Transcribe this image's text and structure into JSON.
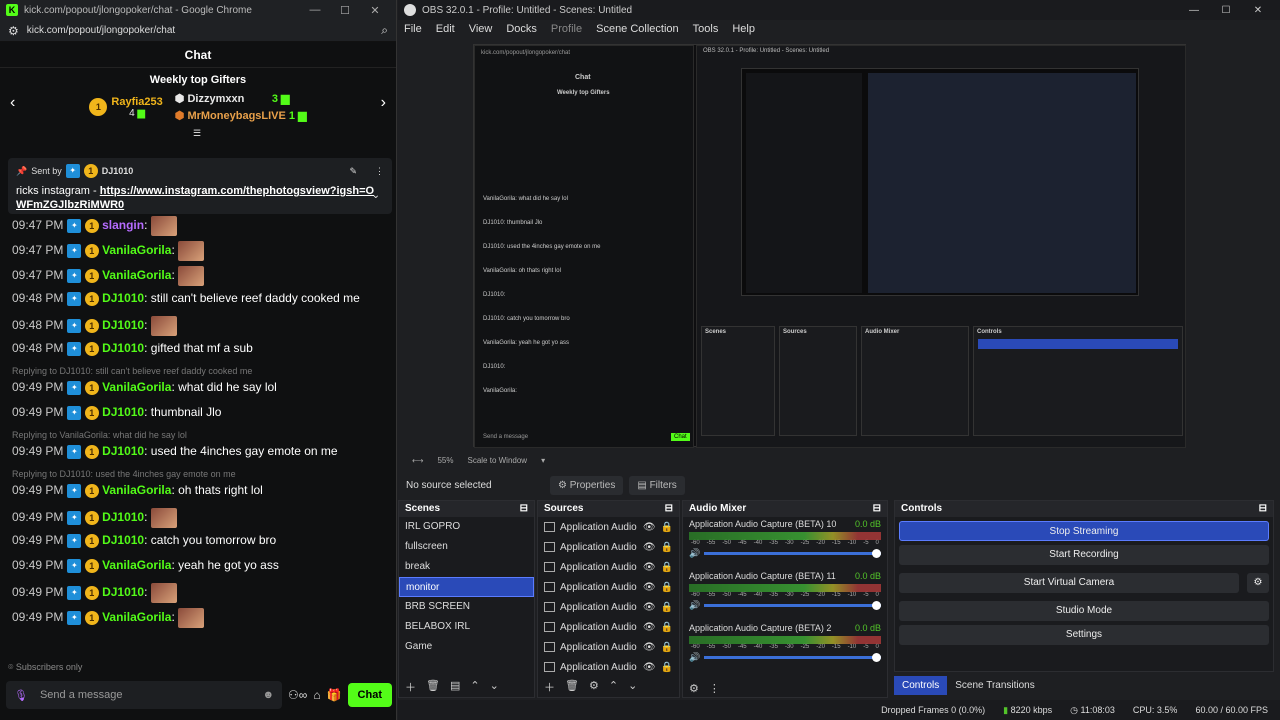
{
  "chrome": {
    "title": "kick.com/popout/jlongopoker/chat - Google Chrome",
    "url": "kick.com/popout/jlongopoker/chat",
    "chat_header": "Chat",
    "gifters_title": "Weekly top Gifters",
    "gifters": [
      {
        "name": "Rayfia253",
        "count": "4",
        "rank": "1"
      },
      {
        "name": "Dizzymxxn",
        "count": "3"
      },
      {
        "name": "MrMoneybagsLIVE",
        "count": "1"
      }
    ],
    "pinned": {
      "sent_by": "Sent by",
      "user": "DJ1010",
      "text": "ricks instagram - ",
      "link": "https://www.instagram.com/thephotogsview?igsh=OWFmZGJlbzRiMWR0"
    },
    "messages": [
      {
        "time": "09:47 PM",
        "user": "slangin",
        "text": ":",
        "color": "#b66cff"
      },
      {
        "time": "09:47 PM",
        "user": "VanilaGorila",
        "text": ":",
        "color": "#53fc18"
      },
      {
        "time": "09:47 PM",
        "user": "VanilaGorila",
        "text": ":",
        "color": "#53fc18"
      },
      {
        "time": "09:48 PM",
        "user": "DJ1010",
        "text": ": still can't believe reef daddy cooked me",
        "color": "#53fc18"
      },
      {
        "time": "09:48 PM",
        "user": "DJ1010",
        "text": ":",
        "color": "#53fc18"
      },
      {
        "time": "09:48 PM",
        "user": "DJ1010",
        "text": ": gifted that mf a sub",
        "color": "#53fc18"
      },
      {
        "time": "09:49 PM",
        "user": "VanilaGorila",
        "text": ": what did he say lol",
        "color": "#53fc18",
        "reply": "Replying to DJ1010: still can't believe reef daddy cooked me"
      },
      {
        "time": "09:49 PM",
        "user": "DJ1010",
        "text": ": thumbnail Jlo",
        "color": "#53fc18"
      },
      {
        "time": "09:49 PM",
        "user": "DJ1010",
        "text": ": used the 4inches gay emote on me",
        "color": "#53fc18",
        "reply": "Replying to VanilaGorila: what did he say lol"
      },
      {
        "time": "09:49 PM",
        "user": "VanilaGorila",
        "text": ": oh thats right lol",
        "color": "#53fc18",
        "reply": "Replying to DJ1010: used the 4inches gay emote on me"
      },
      {
        "time": "09:49 PM",
        "user": "DJ1010",
        "text": ":",
        "color": "#53fc18"
      },
      {
        "time": "09:49 PM",
        "user": "DJ1010",
        "text": ": catch you tomorrow bro",
        "color": "#53fc18"
      },
      {
        "time": "09:49 PM",
        "user": "VanilaGorila",
        "text": ": yeah he got yo ass",
        "color": "#53fc18"
      },
      {
        "time": "09:49 PM",
        "user": "DJ1010",
        "text": ":",
        "color": "#53fc18"
      },
      {
        "time": "09:49 PM",
        "user": "VanilaGorila",
        "text": ":",
        "color": "#53fc18"
      }
    ],
    "overlay_lines": [
      "VanilaGorila: what did he say lol",
      "DJ1010: thumbnail Jlo",
      "DJ1010: used the 4inches gay emote on me",
      "VanilaGorila: oh thats right lol",
      "DJ1010:",
      "DJ1010: catch you tomorrow bro",
      "VanilaGorila: yeah he got yo ass",
      "DJ1010:",
      "VanilaGorila:"
    ],
    "subscribers_only": "Subscribers only",
    "send_placeholder": "Send a message",
    "chat_button": "Chat"
  },
  "obs": {
    "title": "OBS 32.0.1 - Profile: Untitled - Scenes: Untitled",
    "menu": [
      "File",
      "Edit",
      "View",
      "Docks",
      "Profile",
      "Scene Collection",
      "Tools",
      "Help"
    ],
    "zoom": "55%",
    "scale_label": "Scale to Window",
    "no_source": "No source selected",
    "properties": "Properties",
    "filters": "Filters",
    "scenes_title": "Scenes",
    "scenes": [
      "IRL GOPRO",
      "fullscreen",
      "break",
      "monitor",
      "BRB SCREEN",
      "BELABOX IRL",
      "Game"
    ],
    "selected_scene": "monitor",
    "sources_title": "Sources",
    "sources": [
      "Application Audio",
      "Application Audio",
      "Application Audio",
      "Application Audio",
      "Application Audio",
      "Application Audio",
      "Application Audio",
      "Application Audio"
    ],
    "mixer_title": "Audio Mixer",
    "mixer": [
      {
        "name": "Application Audio Capture (BETA) 10",
        "db": "0.0 dB"
      },
      {
        "name": "Application Audio Capture (BETA) 11",
        "db": "0.0 dB"
      },
      {
        "name": "Application Audio Capture (BETA) 2",
        "db": "0.0 dB"
      }
    ],
    "meter_scale": [
      "-60",
      "-55",
      "-50",
      "-45",
      "-40",
      "-35",
      "-30",
      "-25",
      "-20",
      "-15",
      "-10",
      "-5",
      "0"
    ],
    "controls_title": "Controls",
    "controls": [
      "Stop Streaming",
      "Start Recording",
      "Start Virtual Camera",
      "Studio Mode",
      "Settings"
    ],
    "tabs": [
      "Controls",
      "Scene Transitions"
    ],
    "status": {
      "dropped": "Dropped Frames 0 (0.0%)",
      "bitrate": "8220 kbps",
      "time": "11:08:03",
      "cpu": "CPU: 3.5%",
      "fps": "60.00 / 60.00 FPS"
    }
  }
}
